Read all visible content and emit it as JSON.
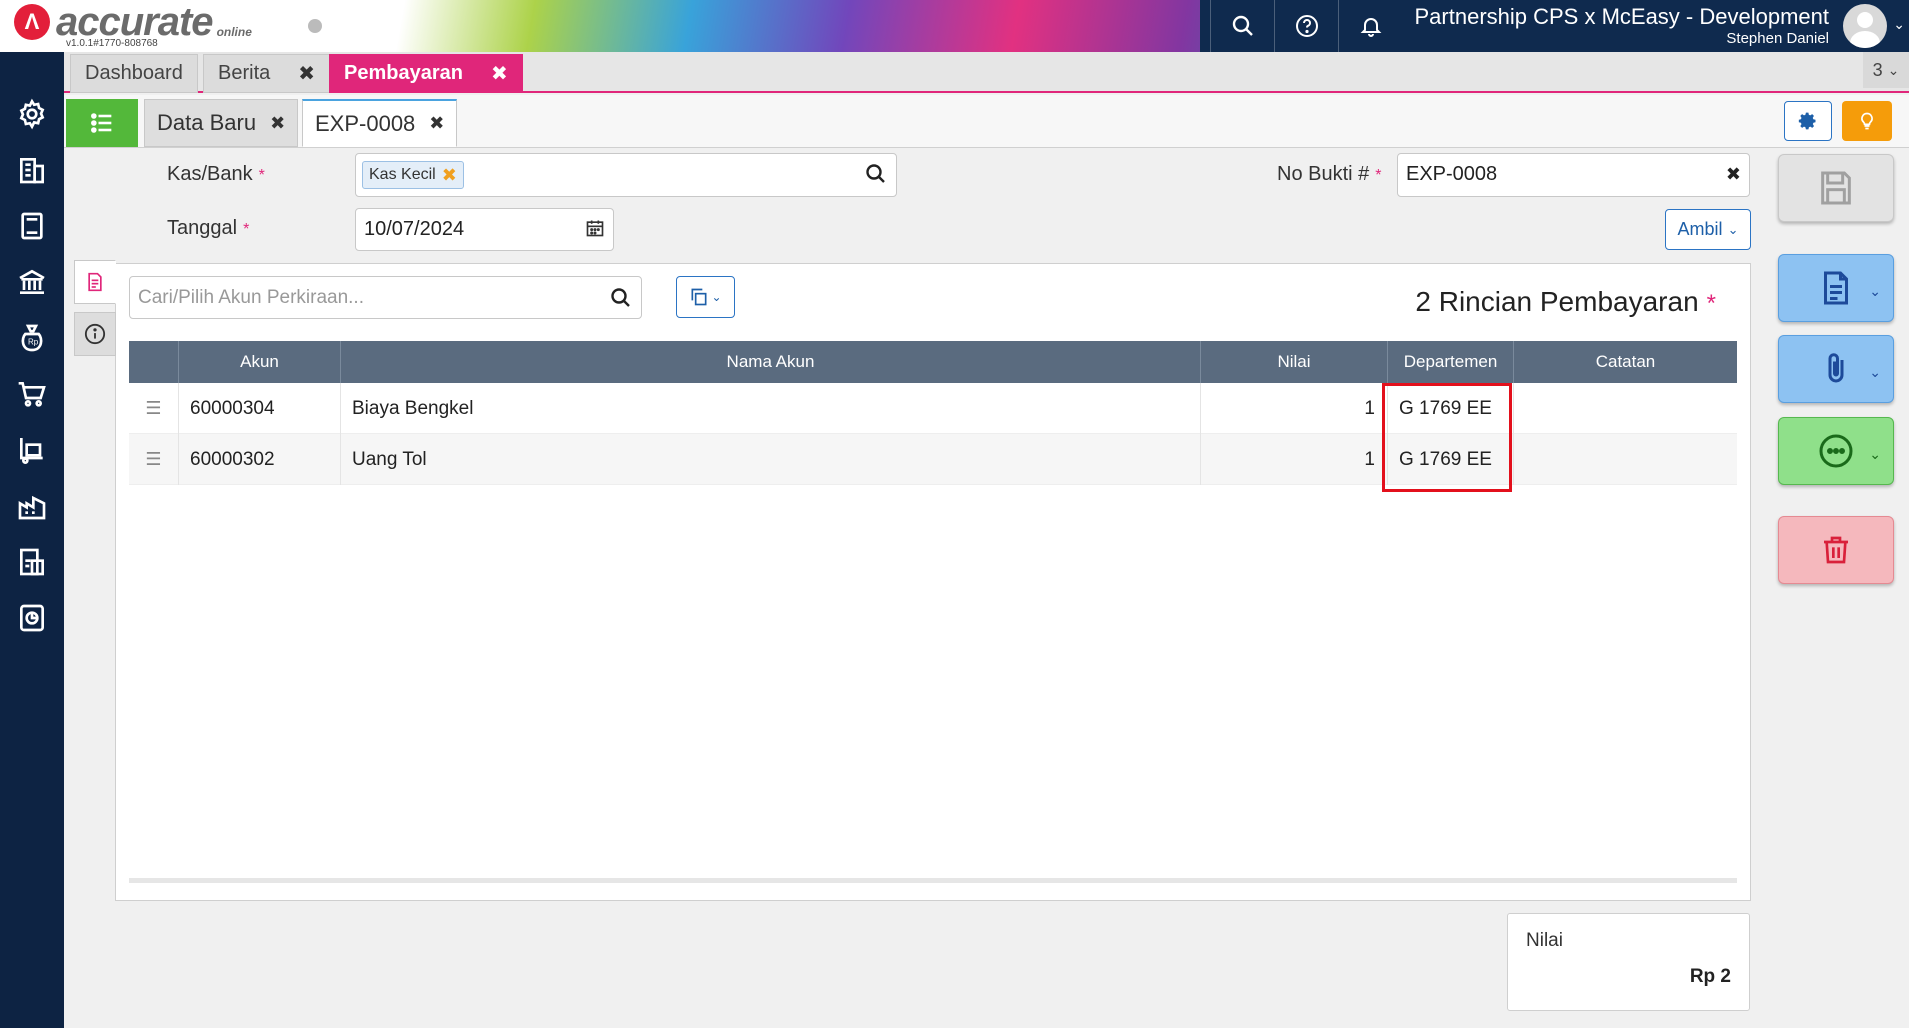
{
  "header": {
    "logo_text": "accurate",
    "logo_sub": "online",
    "version": "v1.0.1#1770-808768",
    "company": "Partnership CPS x McEasy - Development",
    "user": "Stephen Daniel"
  },
  "module_tabs": [
    {
      "label": "Dashboard"
    },
    {
      "label": "Berita"
    },
    {
      "label": "Pembayaran"
    }
  ],
  "module_tab_count": "3",
  "sub_tabs": [
    {
      "label": "Data Baru"
    },
    {
      "label": "EXP-0008"
    }
  ],
  "form": {
    "kas_bank_label": "Kas/Bank",
    "kas_bank_value": "Kas Kecil",
    "tanggal_label": "Tanggal",
    "tanggal_value": "10/07/2024",
    "no_bukti_label": "No Bukti #",
    "no_bukti_value": "EXP-0008",
    "required_mark": "*",
    "ambil_label": "Ambil"
  },
  "detail": {
    "search_placeholder": "Cari/Pilih Akun Perkiraan...",
    "title": "2 Rincian Pembayaran",
    "columns": [
      "Akun",
      "Nama Akun",
      "Nilai",
      "Departemen",
      "Catatan"
    ],
    "rows": [
      {
        "akun": "60000304",
        "nama_akun": "Biaya Bengkel",
        "nilai": "1",
        "departemen": "G 1769 EE",
        "catatan": ""
      },
      {
        "akun": "60000302",
        "nama_akun": "Uang Tol",
        "nilai": "1",
        "departemen": "G 1769 EE",
        "catatan": ""
      }
    ]
  },
  "summary": {
    "label": "Nilai",
    "value": "Rp 2"
  },
  "colors": {
    "accent": "#e0267a",
    "sidebar": "#0d2343",
    "table_header": "#5a6b7f",
    "highlight": "#e3101c"
  }
}
